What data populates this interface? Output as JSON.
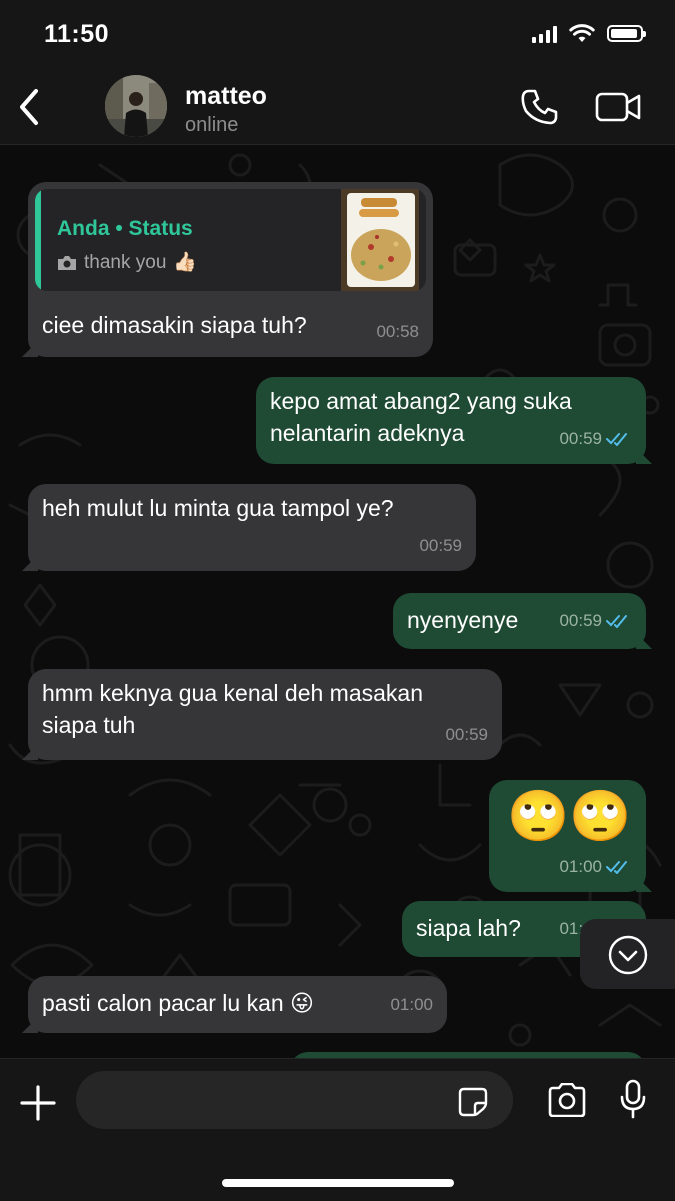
{
  "status_bar": {
    "time": "11:50"
  },
  "header": {
    "contact_name": "matteo",
    "contact_status": "online"
  },
  "messages": [
    {
      "direction": "in",
      "reply_to": {
        "title": "Anda • Status",
        "caption": "thank you",
        "caption_emoji": "👍🏻"
      },
      "text": "ciee dimasakin siapa tuh?",
      "time": "00:58"
    },
    {
      "direction": "out",
      "text": "kepo amat abang2 yang suka\nnelantarin adeknya",
      "time": "00:59",
      "read": true
    },
    {
      "direction": "in",
      "text": "heh mulut lu minta gua tampol ye?",
      "time": "00:59"
    },
    {
      "direction": "out",
      "text": "nyenyenye",
      "time": "00:59",
      "read": true
    },
    {
      "direction": "in",
      "text": "hmm keknya gua kenal deh masakan\nsiapa tuh",
      "time": "00:59"
    },
    {
      "direction": "out",
      "text": "🙄🙄",
      "time": "01:00",
      "read": true
    },
    {
      "direction": "out",
      "text": "siapa lah?",
      "time": "01:00",
      "read": true
    },
    {
      "direction": "in",
      "text": "pasti calon pacar lu kan 😜",
      "time": "01:00"
    }
  ],
  "input": {
    "placeholder": ""
  },
  "colors": {
    "incoming_bubble": "#363638",
    "outgoing_bubble": "#1f4a34",
    "accent": "#2fc69a",
    "read_ticks": "#53bdeb",
    "background": "#0c0c0c"
  }
}
